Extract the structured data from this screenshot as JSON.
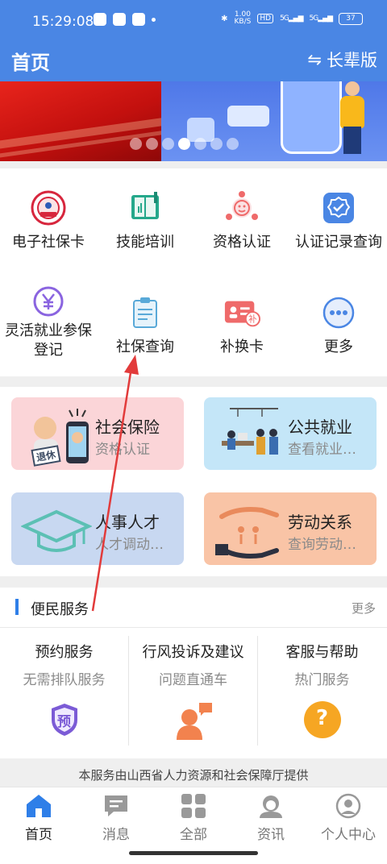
{
  "status_bar": {
    "time": "15:29:08",
    "net_speed_value": "1.00",
    "net_speed_unit": "KB/S",
    "hd": "HD",
    "signal1": "5G",
    "signal2": "5G",
    "battery": "37"
  },
  "header": {
    "title": "首页",
    "elder_mode": "长辈版"
  },
  "banner": {
    "slide_count": 7,
    "active_slide_index": 4
  },
  "grid": [
    {
      "label": "电子社保卡",
      "icon": "social-security-card-icon"
    },
    {
      "label": "技能培训",
      "icon": "book-icon"
    },
    {
      "label": "资格认证",
      "icon": "face-auth-icon"
    },
    {
      "label": "认证记录查询",
      "icon": "badge-check-icon"
    },
    {
      "label": "灵活就业参保登记",
      "icon": "yuan-icon"
    },
    {
      "label": "社保查询",
      "icon": "clipboard-icon"
    },
    {
      "label": "补换卡",
      "icon": "id-card-replace-icon"
    },
    {
      "label": "更多",
      "icon": "more-dots-icon"
    }
  ],
  "tiles": [
    {
      "title": "社会保险",
      "subtitle": "资格认证",
      "bg": "#fbd5d8",
      "badge": "退休"
    },
    {
      "title": "公共就业",
      "subtitle": "查看就业…",
      "bg": "#c4e6f8"
    },
    {
      "title": "人事人才",
      "subtitle": "人才调动…",
      "bg": "#c8d8f1"
    },
    {
      "title": "劳动关系",
      "subtitle": "查询劳动…",
      "bg": "#f9c4a6"
    }
  ],
  "convenience": {
    "title": "便民服务",
    "more": "更多",
    "items": [
      {
        "title": "预约服务",
        "subtitle": "无需排队服务",
        "icon_text": "预"
      },
      {
        "title": "行风投诉及建议",
        "subtitle": "问题直通车"
      },
      {
        "title": "客服与帮助",
        "subtitle": "热门服务",
        "icon_text": "?"
      }
    ]
  },
  "footer_note": "本服务由山西省人力资源和社会保障厅提供",
  "tabs": [
    {
      "label": "首页",
      "active": true
    },
    {
      "label": "消息",
      "active": false
    },
    {
      "label": "全部",
      "active": false
    },
    {
      "label": "资讯",
      "active": false
    },
    {
      "label": "个人中心",
      "active": false
    }
  ],
  "colors": {
    "header_bg": "#4a86e4",
    "accent": "#2f7fe8",
    "annotation_arrow": "#e23b3b"
  }
}
